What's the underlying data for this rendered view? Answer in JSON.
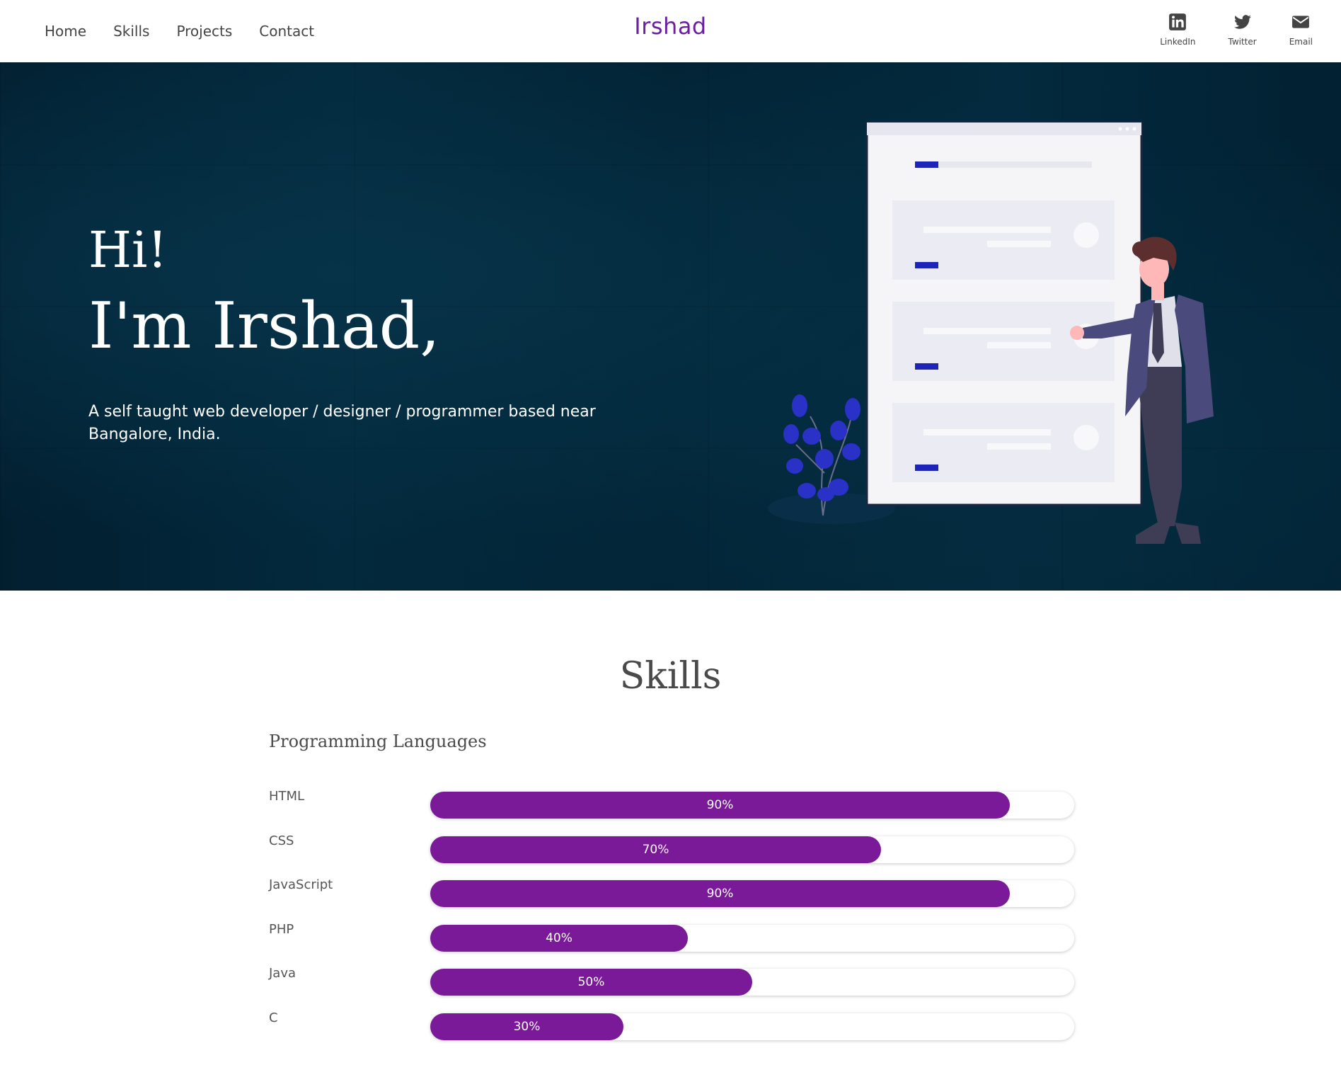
{
  "nav": {
    "links": [
      "Home",
      "Skills",
      "Projects",
      "Contact"
    ],
    "brand": "Irshad",
    "social": [
      {
        "label": "LinkedIn",
        "icon": "linkedin-icon"
      },
      {
        "label": "Twitter",
        "icon": "twitter-icon"
      },
      {
        "label": "Email",
        "icon": "email-icon"
      }
    ]
  },
  "hero": {
    "greeting": "Hi!",
    "name": "I'm Irshad,",
    "tagline": "A self taught web developer / designer / programmer based near Bangalore, India."
  },
  "skills": {
    "title": "Skills",
    "subtitle": "Programming Languages",
    "bar_color": "#7a1a98",
    "items": [
      {
        "name": "HTML",
        "label": "90%",
        "level": 0.9
      },
      {
        "name": "CSS",
        "label": "70%",
        "level": 0.7
      },
      {
        "name": "JavaScript",
        "label": "90%",
        "level": 0.9
      },
      {
        "name": "PHP",
        "label": "40%",
        "level": 0.4
      },
      {
        "name": "Java",
        "label": "50%",
        "level": 0.5
      },
      {
        "name": "C",
        "label": "30%",
        "level": 0.3
      }
    ]
  },
  "colors": {
    "brand": "#6a1fa0",
    "hero_background": "#022536",
    "illustration_accent": "#1d25b8"
  }
}
